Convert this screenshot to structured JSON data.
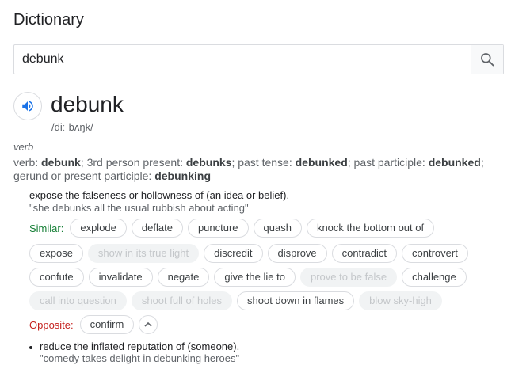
{
  "page": {
    "title": "Dictionary"
  },
  "search": {
    "value": "debunk",
    "button_icon": "search-icon"
  },
  "entry": {
    "word": "debunk",
    "phonetic": "/diːˈbʌŋk/",
    "part_of_speech": "verb",
    "forms": {
      "prefix": "verb: ",
      "base": "debunk",
      "t1": "; 3rd person present: ",
      "third_person": "debunks",
      "t2": "; past tense: ",
      "past": "debunked",
      "t3": "; past participle: ",
      "past_participle": "debunked",
      "t4": ";",
      "t5": "gerund or present participle: ",
      "gerund": "debunking"
    },
    "sense1": {
      "definition": "expose the falseness or hollowness of (an idea or belief).",
      "example": "\"she debunks all the usual rubbish about acting\"",
      "similar_label": "Similar:",
      "rows": [
        [
          {
            "text": "explode",
            "disabled": false
          },
          {
            "text": "deflate",
            "disabled": false
          },
          {
            "text": "puncture",
            "disabled": false
          },
          {
            "text": "quash",
            "disabled": false
          },
          {
            "text": "knock the bottom out of",
            "disabled": false
          }
        ],
        [
          {
            "text": "expose",
            "disabled": false
          },
          {
            "text": "show in its true light",
            "disabled": true
          },
          {
            "text": "discredit",
            "disabled": false
          },
          {
            "text": "disprove",
            "disabled": false
          },
          {
            "text": "contradict",
            "disabled": false
          },
          {
            "text": "controvert",
            "disabled": false
          }
        ],
        [
          {
            "text": "confute",
            "disabled": false
          },
          {
            "text": "invalidate",
            "disabled": false
          },
          {
            "text": "negate",
            "disabled": false
          },
          {
            "text": "give the lie to",
            "disabled": false
          },
          {
            "text": "prove to be false",
            "disabled": true
          },
          {
            "text": "challenge",
            "disabled": false
          }
        ],
        [
          {
            "text": "call into question",
            "disabled": true
          },
          {
            "text": "shoot full of holes",
            "disabled": true
          },
          {
            "text": "shoot down in flames",
            "disabled": false
          },
          {
            "text": "blow sky-high",
            "disabled": true
          }
        ]
      ],
      "opposite_label": "Opposite:",
      "opposites": [
        {
          "text": "confirm",
          "disabled": false
        }
      ],
      "collapse_icon": "chevron-up-icon"
    },
    "sense2": {
      "definition": "reduce the inflated reputation of (someone).",
      "example": "\"comedy takes delight in debunking heroes\""
    }
  },
  "colors": {
    "similar": "#188038",
    "opposite": "#c5221f",
    "accent": "#1a73e8"
  }
}
